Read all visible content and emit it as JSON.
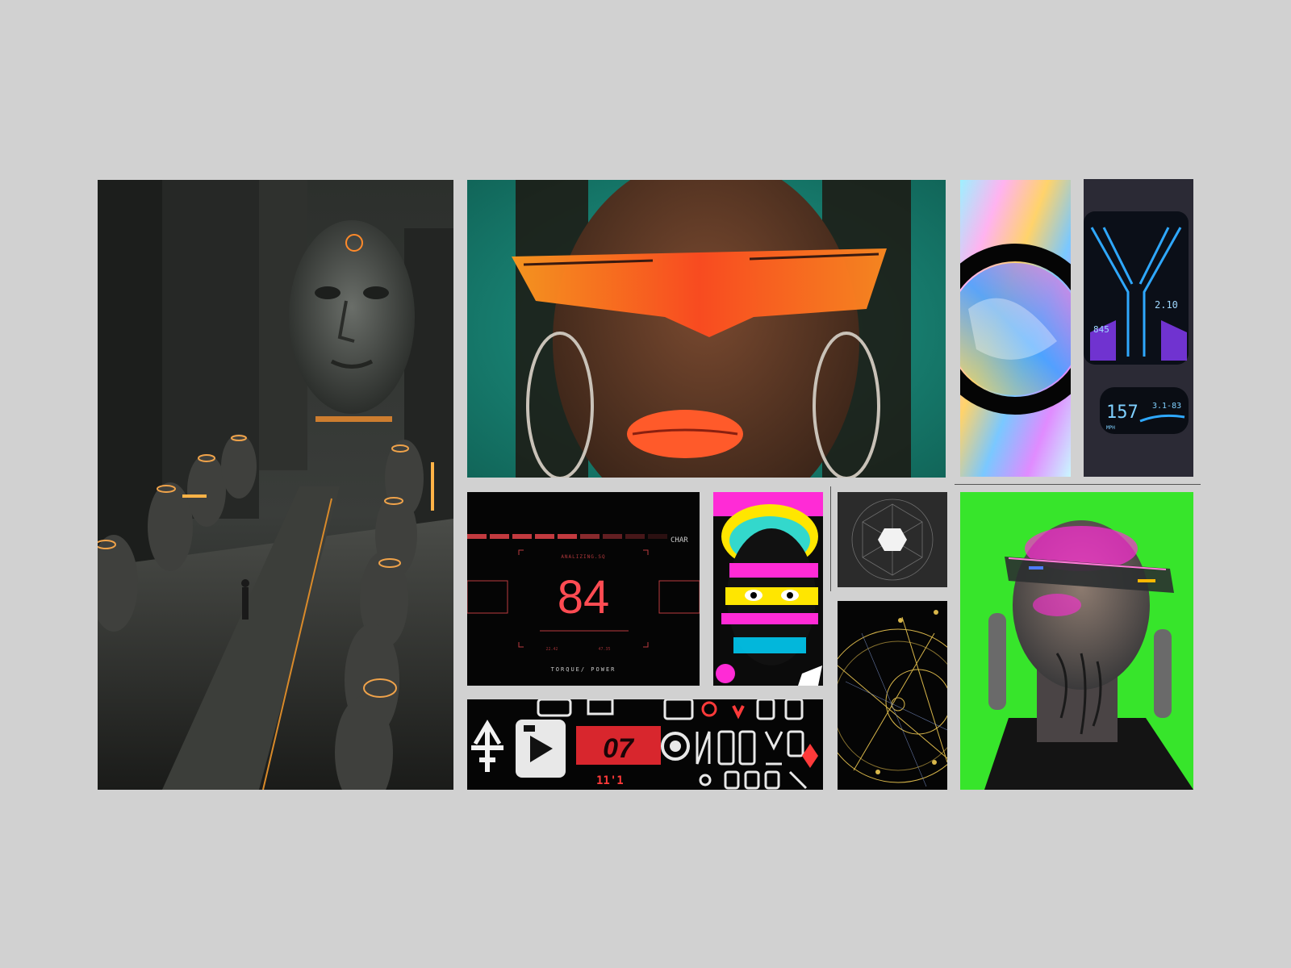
{
  "board": {
    "background": "#d1d1d1",
    "accent_colors": [
      "#ff5a2a",
      "#e8494f",
      "#37ff22",
      "#ff2bd6",
      "#1fd6c9",
      "#ffc400"
    ]
  },
  "hud": {
    "title_partial": "CHAR",
    "status": "ANALIZING.SQ",
    "value": "84",
    "time_left": "22.42",
    "time_right": "47.35",
    "footer": "TORQUE/ POWER"
  },
  "dashboard": {
    "reading_top": "2.10",
    "reading_mid": "845",
    "gear": "157",
    "gear_unit": "MPH",
    "lap": "3.1-83"
  },
  "glyphs": {
    "code": "07",
    "small": "11'1"
  }
}
